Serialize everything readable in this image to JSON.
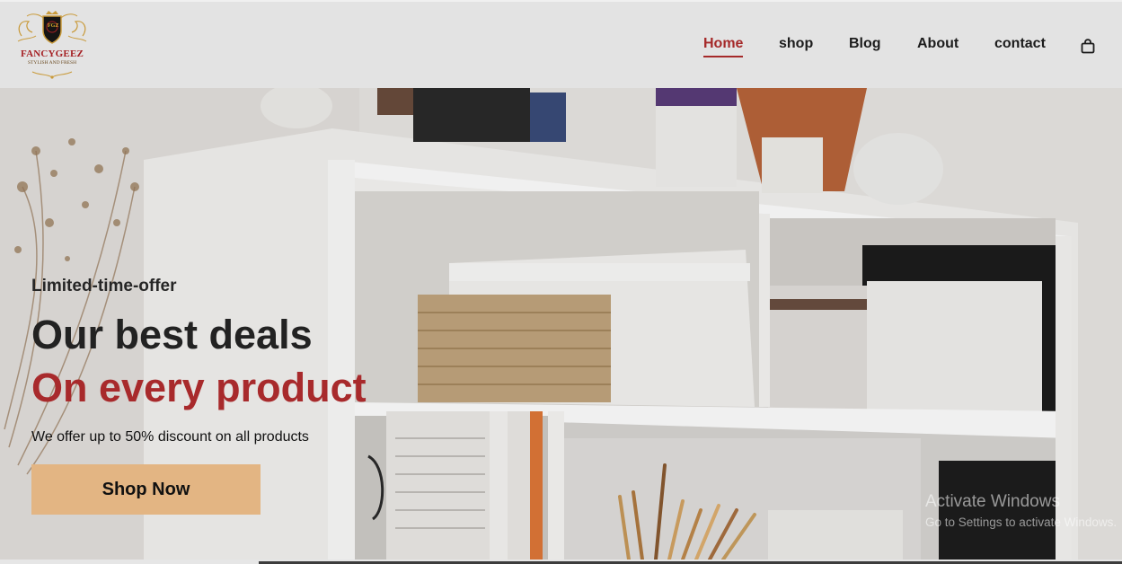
{
  "brand": {
    "name": "FANCYGEEZ",
    "tagline": "STYLISH AND FRESH",
    "monogram": "FGZ",
    "logo_icon": "crest-shield-icon"
  },
  "nav": {
    "items": [
      {
        "label": "Home",
        "active": true
      },
      {
        "label": "shop",
        "active": false
      },
      {
        "label": "Blog",
        "active": false
      },
      {
        "label": "About",
        "active": false
      },
      {
        "label": "contact",
        "active": false
      }
    ],
    "cart_icon": "shopping-bag-icon"
  },
  "hero": {
    "eyebrow": "Limited-time-offer",
    "headline": "Our best deals",
    "headline_accent": "On every product",
    "subtext": "We offer up to 50% discount on all products",
    "cta_label": "Shop Now"
  },
  "watermark": {
    "title": "Activate Windows",
    "subtitle": "Go to Settings to activate Windows."
  },
  "colors": {
    "accent": "#a82a2c",
    "button": "#e3b583",
    "header_bg": "#e3e3e3",
    "text_dark": "#222222"
  }
}
